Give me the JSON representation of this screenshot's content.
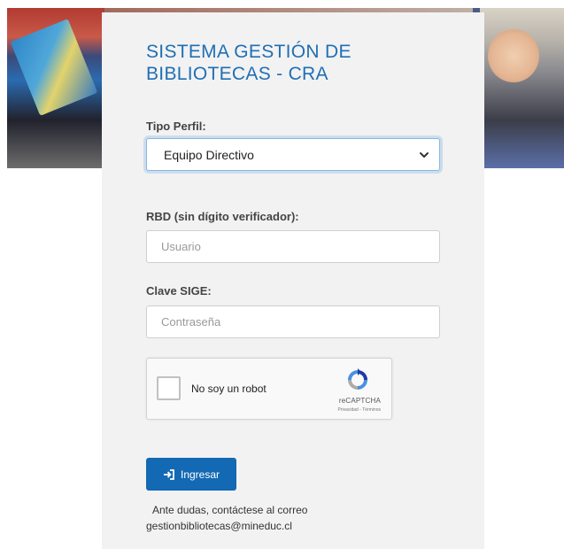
{
  "header": {
    "title_line1": "SISTEMA GESTIÓN DE",
    "title_line2": "BIBLIOTECAS - CRA"
  },
  "form": {
    "tipo_perfil_label": "Tipo Perfil:",
    "tipo_perfil_value": "Equipo Directivo",
    "rbd_label": "RBD (sin dígito verificador):",
    "rbd_placeholder": "Usuario",
    "clave_label": "Clave SIGE:",
    "clave_placeholder": "Contraseña",
    "submit_label": "Ingresar"
  },
  "captcha": {
    "checkbox_label": "No soy un robot",
    "brand": "reCAPTCHA",
    "terms": "Privacidad - Términos"
  },
  "footer": {
    "help_line1": "Ante dudas, contáctese al correo",
    "help_line2": "gestionbibliotecas@mineduc.cl"
  },
  "colors": {
    "accent": "#1369b3",
    "title": "#1f6fb5",
    "card_bg": "#f2f2f2"
  }
}
